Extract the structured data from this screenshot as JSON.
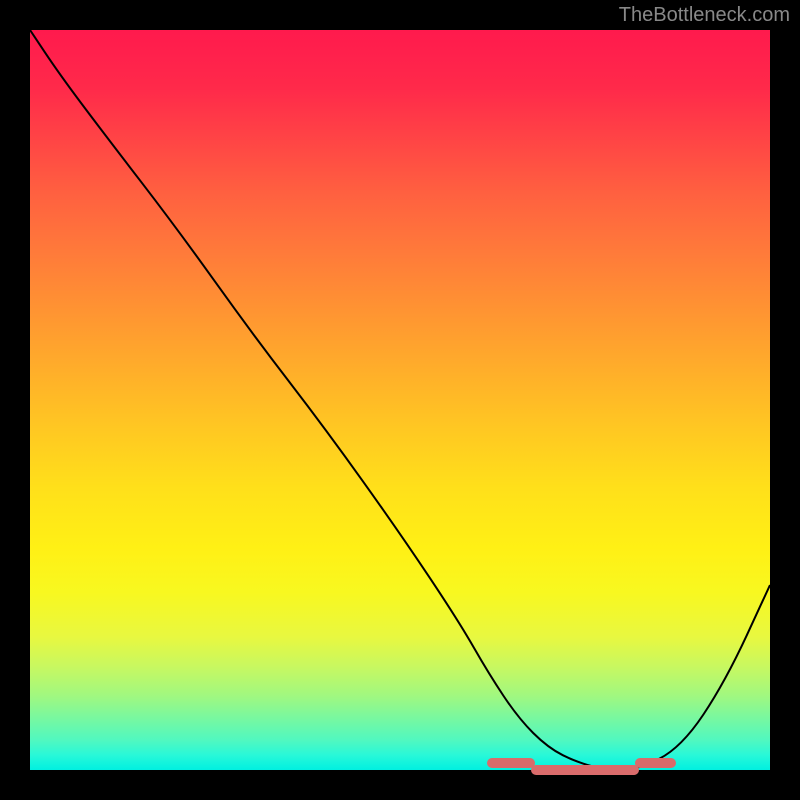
{
  "watermark": "TheBottleneck.com",
  "chart_data": {
    "type": "line",
    "title": "",
    "xlabel": "",
    "ylabel": "",
    "xlim": [
      0,
      100
    ],
    "ylim": [
      0,
      100
    ],
    "series": [
      {
        "name": "curve",
        "x": [
          0,
          4,
          10,
          20,
          30,
          40,
          50,
          58,
          62,
          66,
          70,
          74,
          78,
          82,
          88,
          94,
          100
        ],
        "y": [
          100,
          94,
          86,
          73,
          59,
          46,
          32,
          20,
          13,
          7,
          3,
          1,
          0,
          0,
          3,
          12,
          25
        ]
      }
    ],
    "markers": [
      {
        "x_start": 62,
        "x_end": 68,
        "y": 1
      },
      {
        "x_start": 68,
        "x_end": 82,
        "y": 0
      },
      {
        "x_start": 82,
        "x_end": 87,
        "y": 1
      }
    ],
    "background_gradient": {
      "top": "#ff1a4d",
      "mid": "#ffe01a",
      "bottom": "#00f0e0"
    }
  }
}
